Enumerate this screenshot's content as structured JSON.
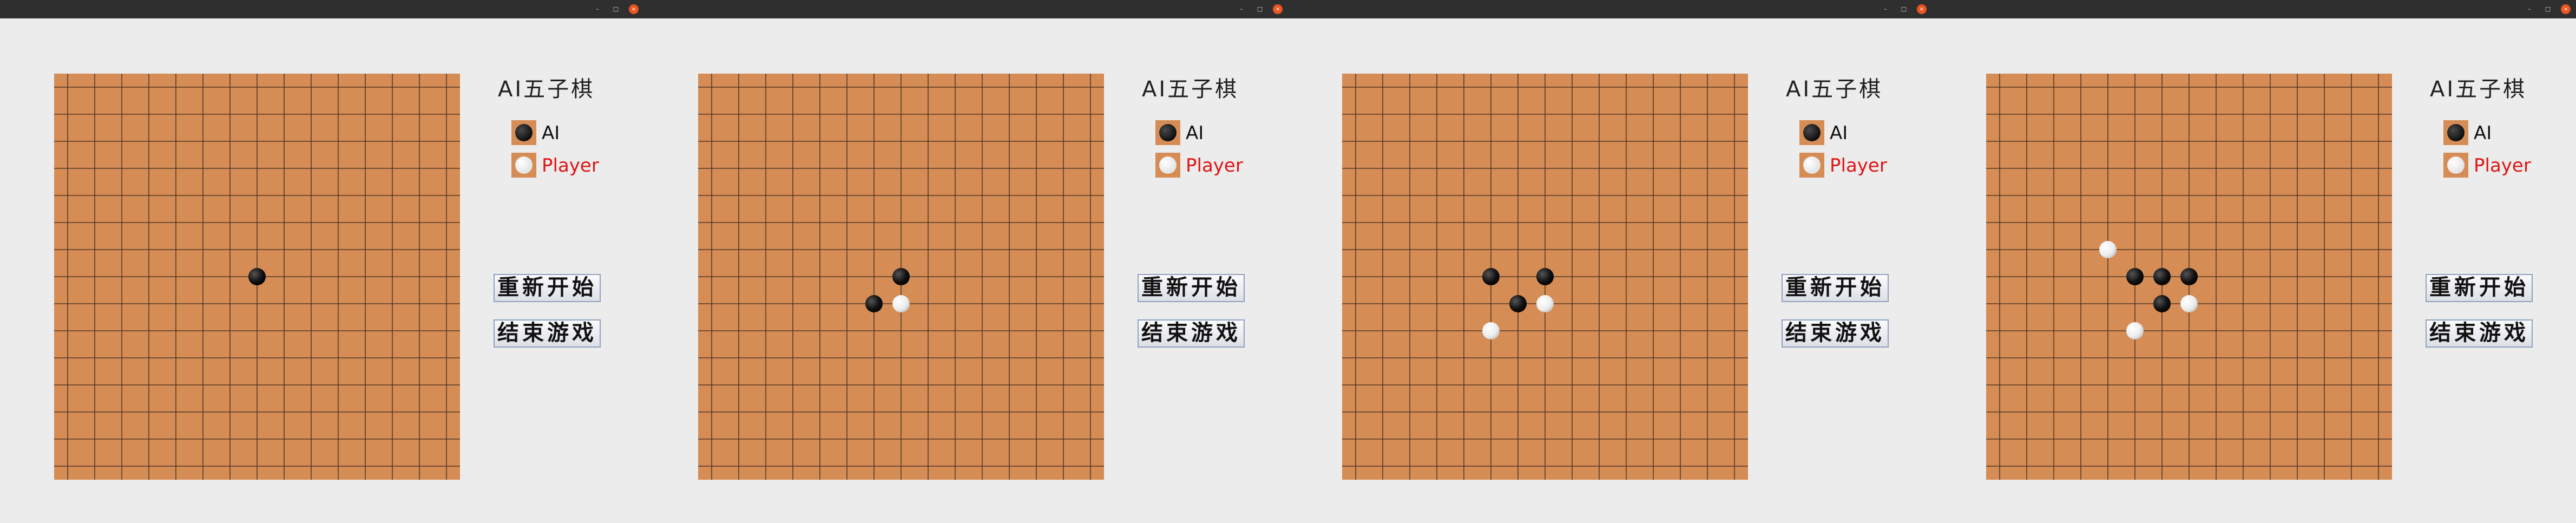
{
  "window_controls": {
    "minimize_glyph": "–",
    "maximize_glyph": "□",
    "close_glyph": "×",
    "close_color": "#e95420"
  },
  "colors": {
    "board": "#d58c55",
    "grid_line": "#3a2a1e",
    "player_label": "#e01414"
  },
  "sidebar": {
    "title": "AI五子棋",
    "ai_label": "AI",
    "player_label": "Player",
    "restart_label": "重新开始",
    "end_label": "结束游戏"
  },
  "board": {
    "size": 15
  },
  "frames": [
    {
      "stones": [
        {
          "col": 7,
          "row": 7,
          "color": "black"
        }
      ]
    },
    {
      "stones": [
        {
          "col": 7,
          "row": 7,
          "color": "black"
        },
        {
          "col": 6,
          "row": 8,
          "color": "black"
        },
        {
          "col": 7,
          "row": 8,
          "color": "white"
        }
      ]
    },
    {
      "stones": [
        {
          "col": 5,
          "row": 7,
          "color": "black"
        },
        {
          "col": 7,
          "row": 7,
          "color": "black"
        },
        {
          "col": 6,
          "row": 8,
          "color": "black"
        },
        {
          "col": 7,
          "row": 8,
          "color": "white"
        },
        {
          "col": 5,
          "row": 9,
          "color": "white"
        }
      ]
    },
    {
      "stones": [
        {
          "col": 4,
          "row": 6,
          "color": "white"
        },
        {
          "col": 5,
          "row": 7,
          "color": "black"
        },
        {
          "col": 6,
          "row": 7,
          "color": "black"
        },
        {
          "col": 7,
          "row": 7,
          "color": "black"
        },
        {
          "col": 6,
          "row": 8,
          "color": "black"
        },
        {
          "col": 7,
          "row": 8,
          "color": "white"
        },
        {
          "col": 5,
          "row": 9,
          "color": "white"
        }
      ]
    }
  ]
}
